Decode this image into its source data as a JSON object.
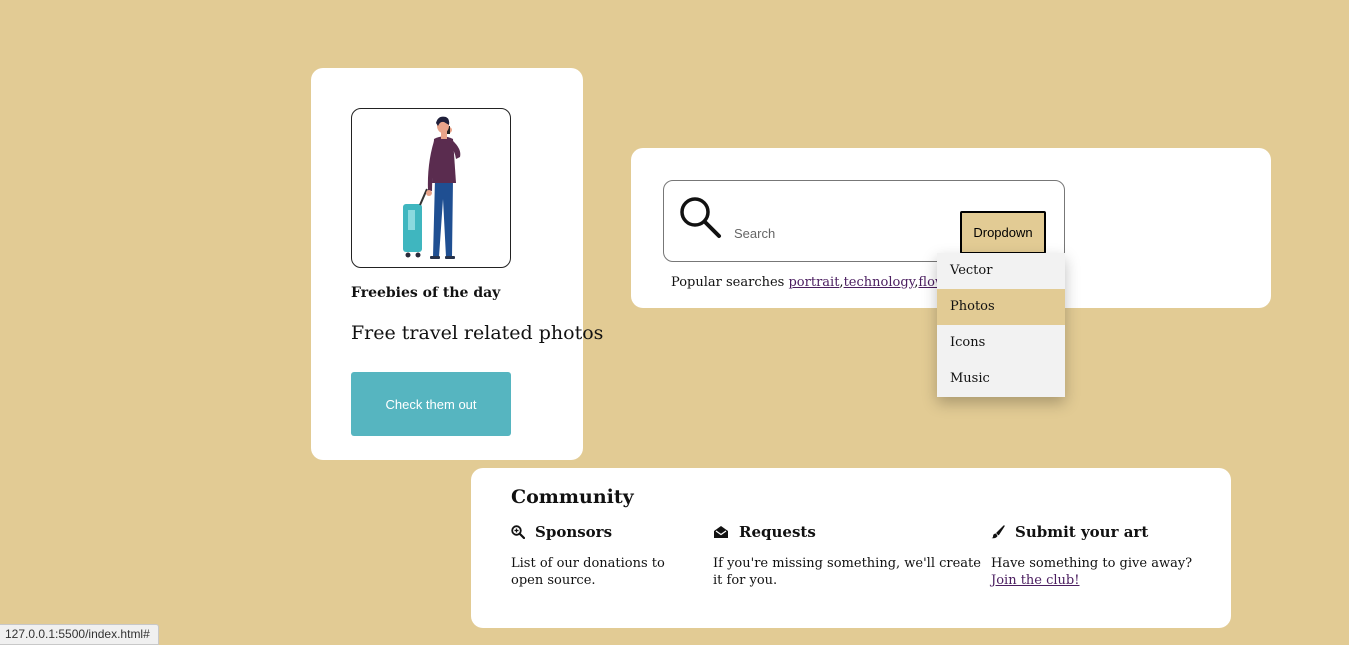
{
  "freebie": {
    "heading": "Freebies of the day",
    "title": "Free travel related photos",
    "button_label": "Check them out"
  },
  "search": {
    "placeholder": "Search",
    "dropdown_label": "Dropdown",
    "popular_label": "Popular searches ",
    "popular_links": [
      "portrait",
      "technology",
      "flowers"
    ]
  },
  "dropdown_menu": {
    "items": [
      "Vector",
      "Photos",
      "Icons",
      "Music"
    ],
    "highlighted": "Photos"
  },
  "community": {
    "title": "Community",
    "columns": [
      {
        "icon": "magnify-icon",
        "heading": "Sponsors",
        "text": "List of our donations to open source."
      },
      {
        "icon": "envelope-open-icon",
        "heading": "Requests",
        "text": "If you're missing something, we'll create it for you."
      },
      {
        "icon": "brush-icon",
        "heading": "Submit your art",
        "text": "Have something to give away?",
        "link": "Join the club!"
      }
    ]
  },
  "status_bar": {
    "url": "127.0.0.1:5500/index.html#"
  },
  "colors": {
    "background": "#e2cb94",
    "button_teal": "#56b5c0",
    "link": "#4a1d5f"
  }
}
